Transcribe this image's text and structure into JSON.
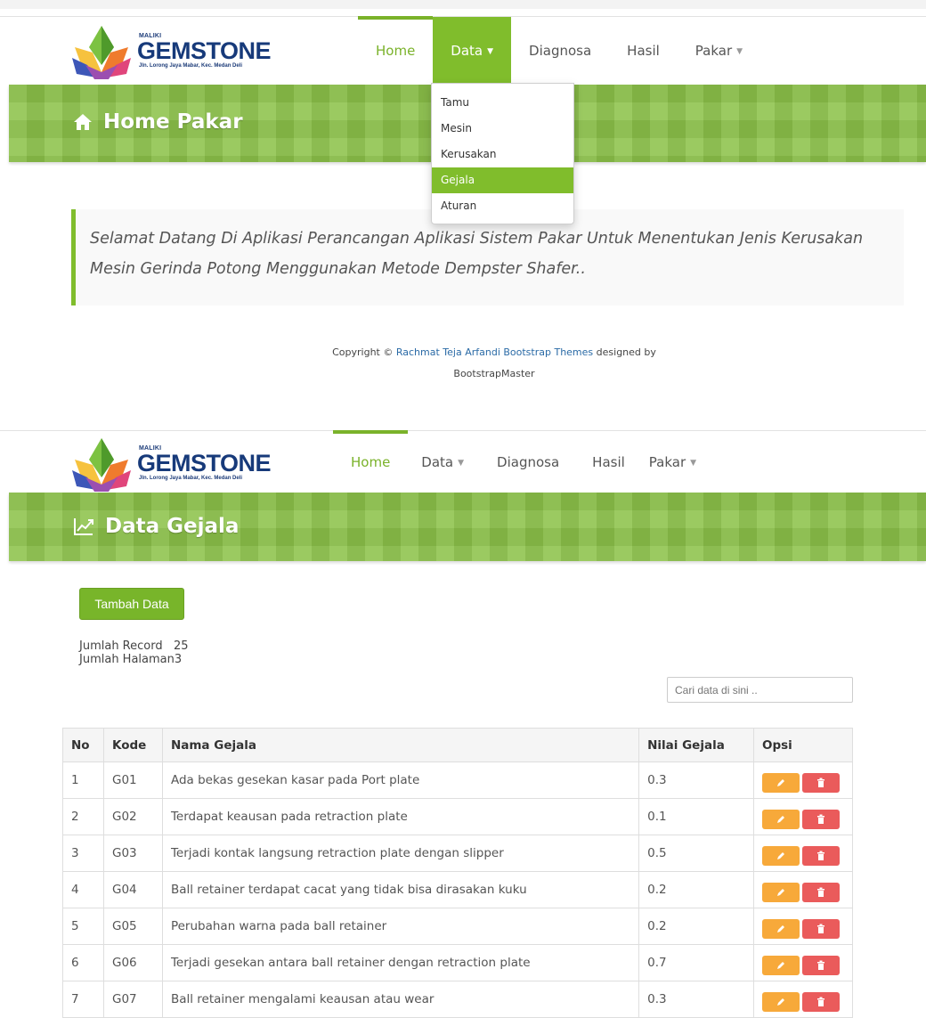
{
  "brand": {
    "small": "MALIKI",
    "name": "GEMSTONE",
    "address": "Jln. Lorong Jaya Mabar, Kec. Medan Deli"
  },
  "nav": {
    "home": "Home",
    "data": "Data",
    "diagnosa": "Diagnosa",
    "hasil": "Hasil",
    "pakar": "Pakar"
  },
  "dropdown": {
    "items": [
      "Tamu",
      "Mesin",
      "Kerusakan",
      "Gejala",
      "Aturan"
    ],
    "active": "Gejala"
  },
  "home_page": {
    "title": "Home Pakar",
    "welcome": "Selamat Datang Di Aplikasi Perancangan Aplikasi Sistem Pakar Untuk Menentukan Jenis Kerusakan Mesin Gerinda Potong Menggunakan Metode Dempster Shafer..",
    "copyright_prefix": "Copyright ©",
    "copyright_link": "Rachmat Teja Arfandi Bootstrap Themes",
    "copyright_suffix": "designed by",
    "copyright_line2": "BootstrapMaster"
  },
  "data_page": {
    "title": "Data Gejala",
    "add_button": "Tambah Data",
    "record_label": "Jumlah Record",
    "record_value": "25",
    "page_label": "Jumlah Halaman",
    "page_value": "3",
    "search_placeholder": "Cari data di sini ..",
    "table": {
      "headers": [
        "No",
        "Kode",
        "Nama Gejala",
        "Nilai Gejala",
        "Opsi"
      ],
      "rows": [
        {
          "no": "1",
          "kode": "G01",
          "nama": "Ada bekas gesekan kasar pada Port plate",
          "nilai": "0.3"
        },
        {
          "no": "2",
          "kode": "G02",
          "nama": "Terdapat keausan pada retraction plate",
          "nilai": "0.1"
        },
        {
          "no": "3",
          "kode": "G03",
          "nama": "Terjadi kontak langsung retraction plate dengan slipper",
          "nilai": "0.5"
        },
        {
          "no": "4",
          "kode": "G04",
          "nama": "Ball retainer terdapat cacat yang tidak bisa dirasakan kuku",
          "nilai": "0.2"
        },
        {
          "no": "5",
          "kode": "G05",
          "nama": "Perubahan warna pada ball retainer",
          "nilai": "0.2"
        },
        {
          "no": "6",
          "kode": "G06",
          "nama": "Terjadi gesekan antara ball retainer dengan retraction plate",
          "nilai": "0.7"
        },
        {
          "no": "7",
          "kode": "G07",
          "nama": "Ball retainer mengalami keausan atau wear",
          "nilai": "0.3"
        }
      ]
    }
  },
  "colors": {
    "accent": "#80bd2c",
    "banner": "#8cc24a",
    "edit": "#f7a93a",
    "delete": "#ea5b5b"
  }
}
